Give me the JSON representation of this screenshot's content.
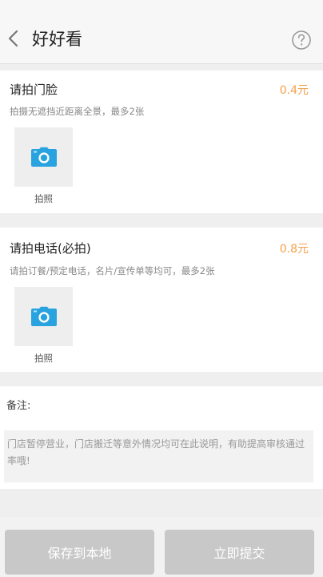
{
  "header": {
    "title": "好好看",
    "back_icon": "chevron-left-icon",
    "help_icon": "question-circle-icon"
  },
  "storefront": {
    "title": "请拍门脸",
    "price": "0.4元",
    "hint": "拍摄无遮挡近距离全景，最多2张",
    "photo_label": "拍照",
    "camera_icon": "camera-icon"
  },
  "phone": {
    "title": "请拍电话(必拍)",
    "price": "0.8元",
    "hint": "请拍订餐/预定电话，名片/宣传单等均可，最多2张",
    "photo_label": "拍照",
    "camera_icon": "camera-icon"
  },
  "remark": {
    "label": "备注:",
    "placeholder": "门店暂停营业，门店搬迁等意外情况均可在此说明，有助提高审核通过率哦!"
  },
  "footer": {
    "save_label": "保存到本地",
    "submit_label": "立即提交"
  },
  "colors": {
    "accent_price": "#f5a04a",
    "camera_blue": "#29a3e0",
    "button_gray": "#c8c8c8"
  }
}
